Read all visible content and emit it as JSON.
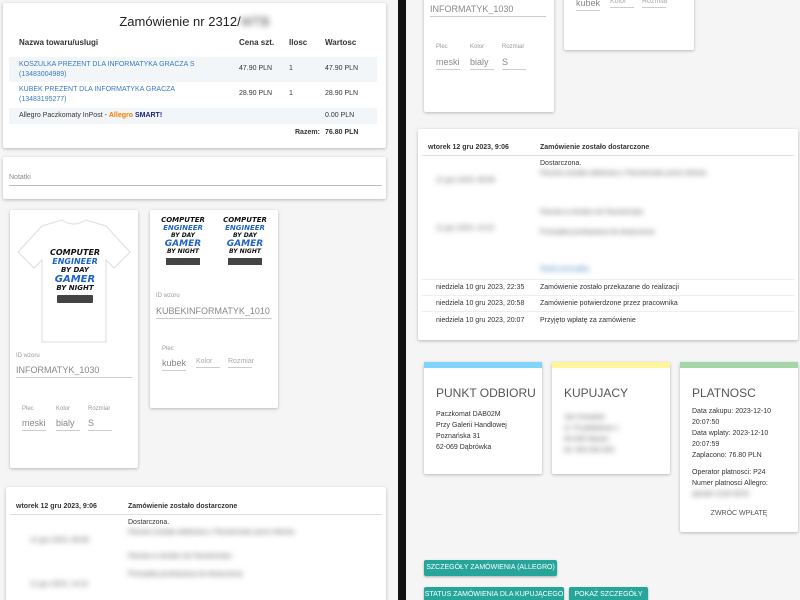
{
  "order": {
    "title": "Zamówienie nr 2312/",
    "title_blurred": "WTB",
    "headers": [
      "Nazwa towaru/uslugi",
      "Cena szt.",
      "Ilosc",
      "Wartosc"
    ],
    "rows": [
      {
        "name": "KOSZULKA PREZENT DLA INFORMATYKA GRACZA S",
        "code": "(13483004989)",
        "price": "47.90 PLN",
        "qty": "1",
        "value": "47.90 PLN"
      },
      {
        "name": "KUBEK PREZENT DLA INFORMATYKA GRACZA",
        "code": "(13483195277)",
        "price": "28.90 PLN",
        "qty": "1",
        "value": "28.90 PLN"
      }
    ],
    "shipping_prefix": "Allegro Paczkomaty InPost - ",
    "shipping_brand1": "Allegro",
    "shipping_brand2": " SMART!",
    "shipping_value": "0.00 PLN",
    "total_label": "Razem:",
    "total_value": "76.80 PLN"
  },
  "notes": {
    "placeholder": "Notatki"
  },
  "product1": {
    "design_label": "ID wzoru",
    "design_value": "INFORMATYK_1030",
    "gender_label": "Plec",
    "gender_value": "meski",
    "color_label": "Kolor",
    "color_value": "bialy",
    "size_label": "Rozmiar",
    "size_value": "S",
    "art": [
      "COMPUTER",
      "ENGINEER",
      "BY DAY",
      "GAMER",
      "BY NIGHT"
    ]
  },
  "product2": {
    "design_label": "ID wzoru",
    "design_value": "KUBEKINFORMATYK_1010",
    "gender_label": "Plec",
    "gender_value": "kubek",
    "color_label": "Kolor",
    "color_value": "",
    "size_label": "Rozmiar",
    "size_value": "",
    "art": [
      "COMPUTER",
      "ENGINEER",
      "BY DAY",
      "GAMER",
      "BY NIGHT"
    ]
  },
  "history": {
    "head_date": "wtorek 12 gru 2023, 9:06",
    "head_status": "Zamówienie zostało dostarczone",
    "delivered": "Dostarczona.",
    "delivered_blur": "Paczka została odebrana z Paczkomatu przez klienta.",
    "blur_lines": [
      "12 gru 2023, 09:06",
      "Paczka w drodze do Paczkomatu",
      "Przesyłka przekazana do doręczenia",
      "11 gru 2023, 14:22",
      "Przesyłka odebrana od nadawcy",
      "Śledź przesyłkę"
    ],
    "entries": [
      {
        "date": "niedziela 10 gru 2023, 22:35",
        "status": "Zamówienie zostało przekazane do realizacji"
      },
      {
        "date": "niedziela 10 gru 2023, 20:58",
        "status": "Zamówienie potwierdzone przez pracownika"
      },
      {
        "date": "niedziela 10 gru 2023, 20:07",
        "status": "Przyjęto wpłatę za zamówienie"
      }
    ]
  },
  "pickup": {
    "title": "PUNKT ODBIORU",
    "color": "#81d4fa",
    "lines": [
      "Paczkomat DAB02M",
      "Przy Galerii Handlowej",
      "Poznańska 31",
      "62-069 Dąbrówka"
    ]
  },
  "buyer": {
    "title": "KUPUJACY",
    "color": "#fff59d",
    "lines": [
      "Jan Kowalski",
      "ul. Przykładowa 1",
      "00-000 Miasto",
      "tel. 000 000 000"
    ]
  },
  "payment": {
    "title": "PLATNOSC",
    "color": "#a5d6a7",
    "purchase": "Data zakupu: 2023-12-10 20:07:50",
    "payment_date": "Data wplaty: 2023-12-10 20:07:59",
    "paid": "Zaplacono: 76.80 PLN",
    "operator": "Operator platnosci: P24",
    "number_label": "Numer platnosci Allegro:",
    "number_blur": "abcdef-1234-5678",
    "refund": "ZWRÓC WPŁATĘ"
  },
  "buttons": {
    "details_allegro": "SZCZEGÓŁY ZAMÓWIENIA (ALLEGRO)",
    "status_buyer": "STATUS ZAMÓWIENIA DLA KUPUJĄCEGO",
    "show_details": "POKAŻ SZCZEGÓŁY"
  }
}
